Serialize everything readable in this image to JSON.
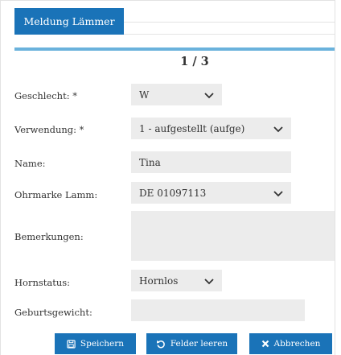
{
  "tab": {
    "label": "Meldung Lämmer"
  },
  "pager": {
    "text": "1 / 3"
  },
  "form": {
    "geschlecht": {
      "label": "Geschlecht: *",
      "value": "W"
    },
    "verwendung": {
      "label": "Verwendung: *",
      "value": "1 - aufgestellt (aufge)"
    },
    "name": {
      "label": "Name:",
      "value": "Tina"
    },
    "ohrmarke": {
      "label": "Ohrmarke Lamm:",
      "value": "DE 01097113"
    },
    "bemerkungen": {
      "label": "Bemerkungen:",
      "value": ""
    },
    "hornstatus": {
      "label": "Hornstatus:",
      "value": "Hornlos"
    },
    "geburtsgewicht": {
      "label": "Geburtsgewicht:",
      "value": ""
    }
  },
  "buttons": {
    "save": "Speichern",
    "clear": "Felder leeren",
    "cancel": "Abbrechen"
  },
  "colors": {
    "accent": "#1a73b8",
    "bar": "#6ab2dc",
    "field": "#ececec"
  }
}
